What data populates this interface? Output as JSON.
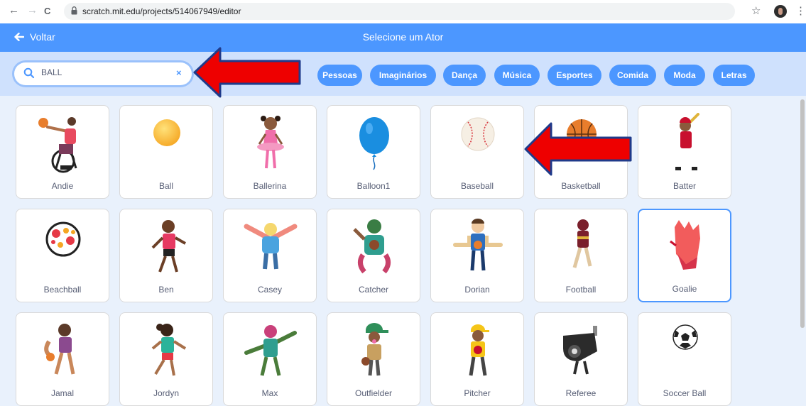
{
  "browser": {
    "url": "scratch.mit.edu/projects/514067949/editor",
    "back_glyph": "←",
    "forward_glyph": "→",
    "reload_glyph": "C",
    "star_glyph": "☆",
    "menu_glyph": "⋮"
  },
  "header": {
    "back_label": "Voltar",
    "title": "Selecione um Ator"
  },
  "search": {
    "value": "BALL",
    "clear_glyph": "×"
  },
  "categories": [
    "Pessoas",
    "Imaginários",
    "Dança",
    "Música",
    "Esportes",
    "Comida",
    "Moda",
    "Letras"
  ],
  "sprites": [
    "Andie",
    "Ball",
    "Ballerina",
    "Balloon1",
    "Baseball",
    "Basketball",
    "Batter",
    "Beachball",
    "Ben",
    "Casey",
    "Catcher",
    "Dorian",
    "Football",
    "Goalie",
    "Jamal",
    "Jordyn",
    "Max",
    "Outfielder",
    "Pitcher",
    "Referee",
    "Soccer Ball"
  ],
  "selected_sprite": "Goalie",
  "colors": {
    "header_blue": "#4c97ff",
    "filter_bar": "#cfe1fd",
    "annotation_arrow": "#ee0000"
  }
}
